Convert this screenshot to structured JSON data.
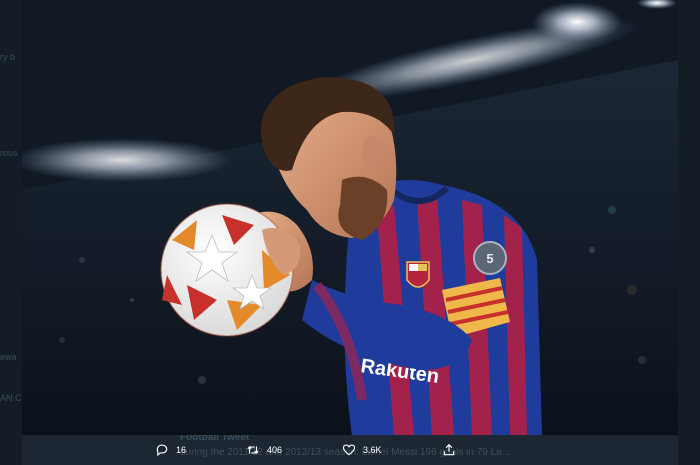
{
  "background_page": {
    "left_fragments": [
      "ry b",
      "rous",
      "ewa",
      "AN CI"
    ],
    "caption_handle": "Football Tweet",
    "caption_line": "during the 2011/12 and 2012/13 season: Lionel Messi 196 goals in 79 La..."
  },
  "photo": {
    "alt_subject": "Footballer in blue and red striped kit holding a star-patterned ball",
    "kit_sponsor": "Rakuten",
    "badge_number": "5"
  },
  "actions": {
    "reply": {
      "icon": "reply-icon",
      "count": "16"
    },
    "retweet": {
      "icon": "retweet-icon",
      "count": "406"
    },
    "like": {
      "icon": "heart-icon",
      "count": "3.6K"
    },
    "share": {
      "icon": "share-icon"
    }
  },
  "colors": {
    "page_bg": "#15202b",
    "kit_blue": "#1f3c9c",
    "kit_red": "#a3224c",
    "ball_red": "#c8312b",
    "ball_orange": "#e58a2a"
  }
}
